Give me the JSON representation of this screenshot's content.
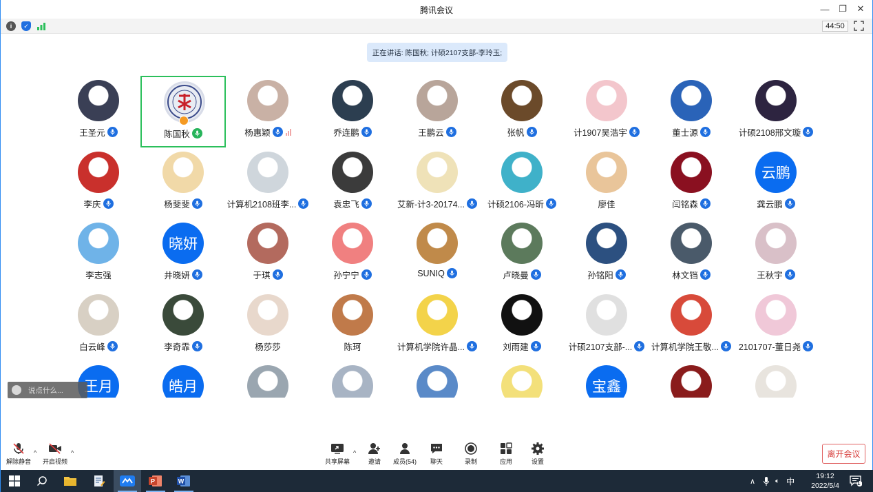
{
  "window": {
    "title": "腾讯会议",
    "controls": [
      "—",
      "❐",
      "✕"
    ]
  },
  "infobar": {
    "timer": "44:50"
  },
  "speaking": {
    "text": "正在讲话: 陈国秋; 计硕2107支部-李玲玉;"
  },
  "participants": [
    {
      "name": "王圣元",
      "avatar": "photo",
      "color": "#3a3f55"
    },
    {
      "name": "陈国秋",
      "avatar": "seal",
      "color": "#e9ecf3",
      "active": true,
      "mic": "green"
    },
    {
      "name": "杨惠颖",
      "avatar": "photo",
      "color": "#c9b1a5",
      "volume": true
    },
    {
      "name": "乔连鹏",
      "avatar": "photo",
      "color": "#2c3e50"
    },
    {
      "name": "王鹏云",
      "avatar": "photo",
      "color": "#b8a59a"
    },
    {
      "name": "张帆",
      "avatar": "photo",
      "color": "#6b4a2a"
    },
    {
      "name": "计1907吴浩宇",
      "avatar": "photo",
      "color": "#f3c6cc"
    },
    {
      "name": "董士源",
      "avatar": "photo",
      "color": "#2a63b8"
    },
    {
      "name": "计硕2108邢文璇",
      "avatar": "photo",
      "color": "#2d2440"
    },
    {
      "name": "李庆",
      "avatar": "photo",
      "color": "#c9302c"
    },
    {
      "name": "杨斐斐",
      "avatar": "photo",
      "color": "#f1d9a8"
    },
    {
      "name": "计算机2108班李...",
      "avatar": "photo",
      "color": "#cfd6dc"
    },
    {
      "name": "袁忠飞",
      "avatar": "photo",
      "color": "#3b3b3b"
    },
    {
      "name": "艾新-计3-20174...",
      "avatar": "photo",
      "color": "#efe2b8"
    },
    {
      "name": "计硕2106-冯昕",
      "avatar": "photo",
      "color": "#3fb1c9"
    },
    {
      "name": "廖佳",
      "avatar": "photo",
      "color": "#e9c59a",
      "mic": "none"
    },
    {
      "name": "闫铭森",
      "avatar": "photo",
      "color": "#8a1020"
    },
    {
      "name": "龚云鹏",
      "avatar": "text",
      "initials": "云鹏"
    },
    {
      "name": "李志强",
      "avatar": "photo",
      "color": "#6fb3e8",
      "mic": "none"
    },
    {
      "name": "井晓妍",
      "avatar": "text",
      "initials": "晓妍"
    },
    {
      "name": "于琪",
      "avatar": "photo",
      "color": "#b36a5e"
    },
    {
      "name": "孙宁宁",
      "avatar": "photo",
      "color": "#f08080"
    },
    {
      "name": "SUNIQ",
      "avatar": "photo",
      "color": "#c08a4a"
    },
    {
      "name": "卢晓曼",
      "avatar": "photo",
      "color": "#5c7a5c"
    },
    {
      "name": "孙铭阳",
      "avatar": "photo",
      "color": "#2c5080"
    },
    {
      "name": "林文铛",
      "avatar": "photo",
      "color": "#4a5a6a"
    },
    {
      "name": "王秋宇",
      "avatar": "photo",
      "color": "#d9c0c8"
    },
    {
      "name": "白云峰",
      "avatar": "photo",
      "color": "#d8d0c4"
    },
    {
      "name": "李奇霏",
      "avatar": "photo",
      "color": "#3a4a3a"
    },
    {
      "name": "杨莎莎",
      "avatar": "photo",
      "color": "#e8d8cc",
      "mic": "none"
    },
    {
      "name": "陈珂",
      "avatar": "photo",
      "color": "#c07a4a",
      "mic": "none"
    },
    {
      "name": "计算机学院许晶...",
      "avatar": "photo",
      "color": "#f3d34a"
    },
    {
      "name": "刘雨建",
      "avatar": "photo",
      "color": "#111111"
    },
    {
      "name": "计硕2107支部-...",
      "avatar": "photo",
      "color": "#e0e0e0"
    },
    {
      "name": "计算机学院王敬...",
      "avatar": "photo",
      "color": "#d84a3a"
    },
    {
      "name": "2101707-董日尧",
      "avatar": "photo",
      "color": "#f0c8d8"
    },
    {
      "name": "",
      "avatar": "text",
      "initials": "王月",
      "mic": "none"
    },
    {
      "name": "",
      "avatar": "text",
      "initials": "皓月",
      "mic": "none"
    },
    {
      "name": "",
      "avatar": "photo",
      "color": "#9aa6b0",
      "mic": "none"
    },
    {
      "name": "",
      "avatar": "photo",
      "color": "#a8b4c4",
      "mic": "none"
    },
    {
      "name": "",
      "avatar": "photo",
      "color": "#5a8ac8",
      "mic": "none"
    },
    {
      "name": "",
      "avatar": "photo",
      "color": "#f3e07a",
      "mic": "none"
    },
    {
      "name": "",
      "avatar": "text",
      "initials": "宝鑫",
      "mic": "none"
    },
    {
      "name": "",
      "avatar": "photo",
      "color": "#8a1c1c",
      "mic": "none"
    },
    {
      "name": "",
      "avatar": "photo",
      "color": "#e8e4de",
      "mic": "none"
    }
  ],
  "chat": {
    "placeholder": "说点什么..."
  },
  "toolbar": {
    "unmute": "解除静音",
    "video": "开启视频",
    "share": "共享屏幕",
    "invite": "邀请",
    "members": "成员(54)",
    "chat": "聊天",
    "record": "录制",
    "apps": "应用",
    "settings": "设置",
    "leave": "离开会议"
  },
  "taskbar": {
    "ime": "中",
    "time": "19:12",
    "date": "2022/5/4",
    "notifications": "1"
  }
}
